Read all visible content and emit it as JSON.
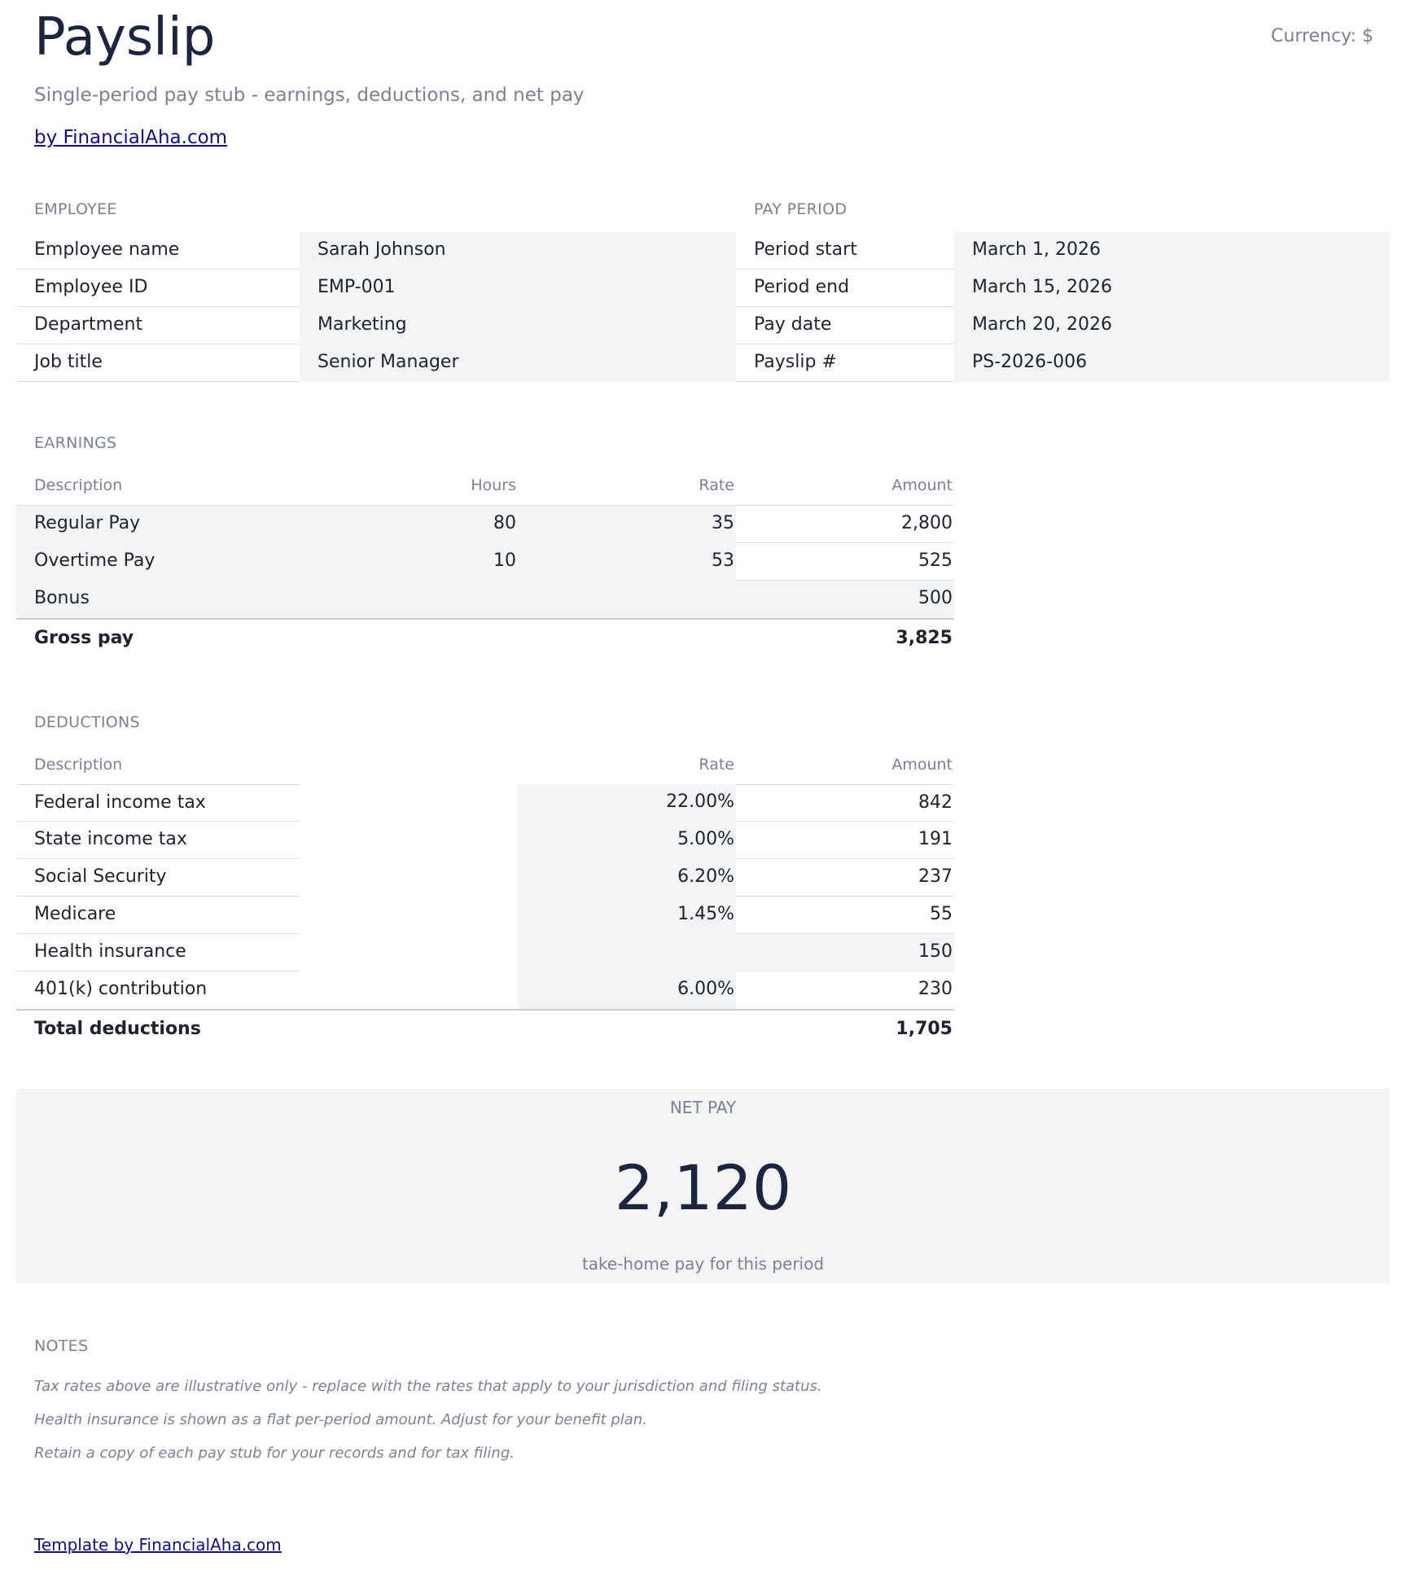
{
  "header": {
    "title": "Payslip",
    "currency": "Currency: $",
    "subtitle": "Single-period pay stub - earnings, deductions, and net pay",
    "byline": "by FinancialAha.com"
  },
  "employee": {
    "label": "EMPLOYEE",
    "rows": [
      {
        "key": "Employee name",
        "value": "Sarah Johnson"
      },
      {
        "key": "Employee ID",
        "value": "EMP-001"
      },
      {
        "key": "Department",
        "value": "Marketing"
      },
      {
        "key": "Job title",
        "value": "Senior Manager"
      }
    ]
  },
  "pay_period": {
    "label": "PAY PERIOD",
    "rows": [
      {
        "key": "Period start",
        "value": "March 1, 2026"
      },
      {
        "key": "Period end",
        "value": "March 15, 2026"
      },
      {
        "key": "Pay date",
        "value": "March 20, 2026"
      },
      {
        "key": "Payslip #",
        "value": "PS-2026-006"
      }
    ]
  },
  "earnings": {
    "label": "EARNINGS",
    "headers": {
      "description": "Description",
      "hours": "Hours",
      "rate": "Rate",
      "amount": "Amount"
    },
    "rows": [
      {
        "description": "Regular Pay",
        "hours": "80",
        "rate": "35",
        "amount": "2,800"
      },
      {
        "description": "Overtime Pay",
        "hours": "10",
        "rate": "53",
        "amount": "525"
      },
      {
        "description": "Bonus",
        "hours": "",
        "rate": "",
        "amount": "500"
      }
    ],
    "total_label": "Gross pay",
    "total_value": "3,825"
  },
  "deductions": {
    "label": "DEDUCTIONS",
    "headers": {
      "description": "Description",
      "rate": "Rate",
      "amount": "Amount"
    },
    "rows": [
      {
        "description": "Federal income tax",
        "rate": "22.00%",
        "amount": "842"
      },
      {
        "description": "State income tax",
        "rate": "5.00%",
        "amount": "191"
      },
      {
        "description": "Social Security",
        "rate": "6.20%",
        "amount": "237"
      },
      {
        "description": "Medicare",
        "rate": "1.45%",
        "amount": "55"
      },
      {
        "description": "Health insurance",
        "rate": "",
        "amount": "150"
      },
      {
        "description": "401(k) contribution",
        "rate": "6.00%",
        "amount": "230"
      }
    ],
    "total_label": "Total deductions",
    "total_value": "1,705"
  },
  "net_pay": {
    "label": "NET PAY",
    "value": "2,120",
    "caption": "take-home pay for this period"
  },
  "notes": {
    "label": "NOTES",
    "items": [
      "Tax rates above are illustrative only - replace with the rates that apply to your jurisdiction and filing status.",
      "Health insurance is shown as a flat per-period amount. Adjust for your benefit plan.",
      "Retain a copy of each pay stub for your records and for tax filing."
    ]
  },
  "footer": {
    "link": "Template by FinancialAha.com"
  }
}
